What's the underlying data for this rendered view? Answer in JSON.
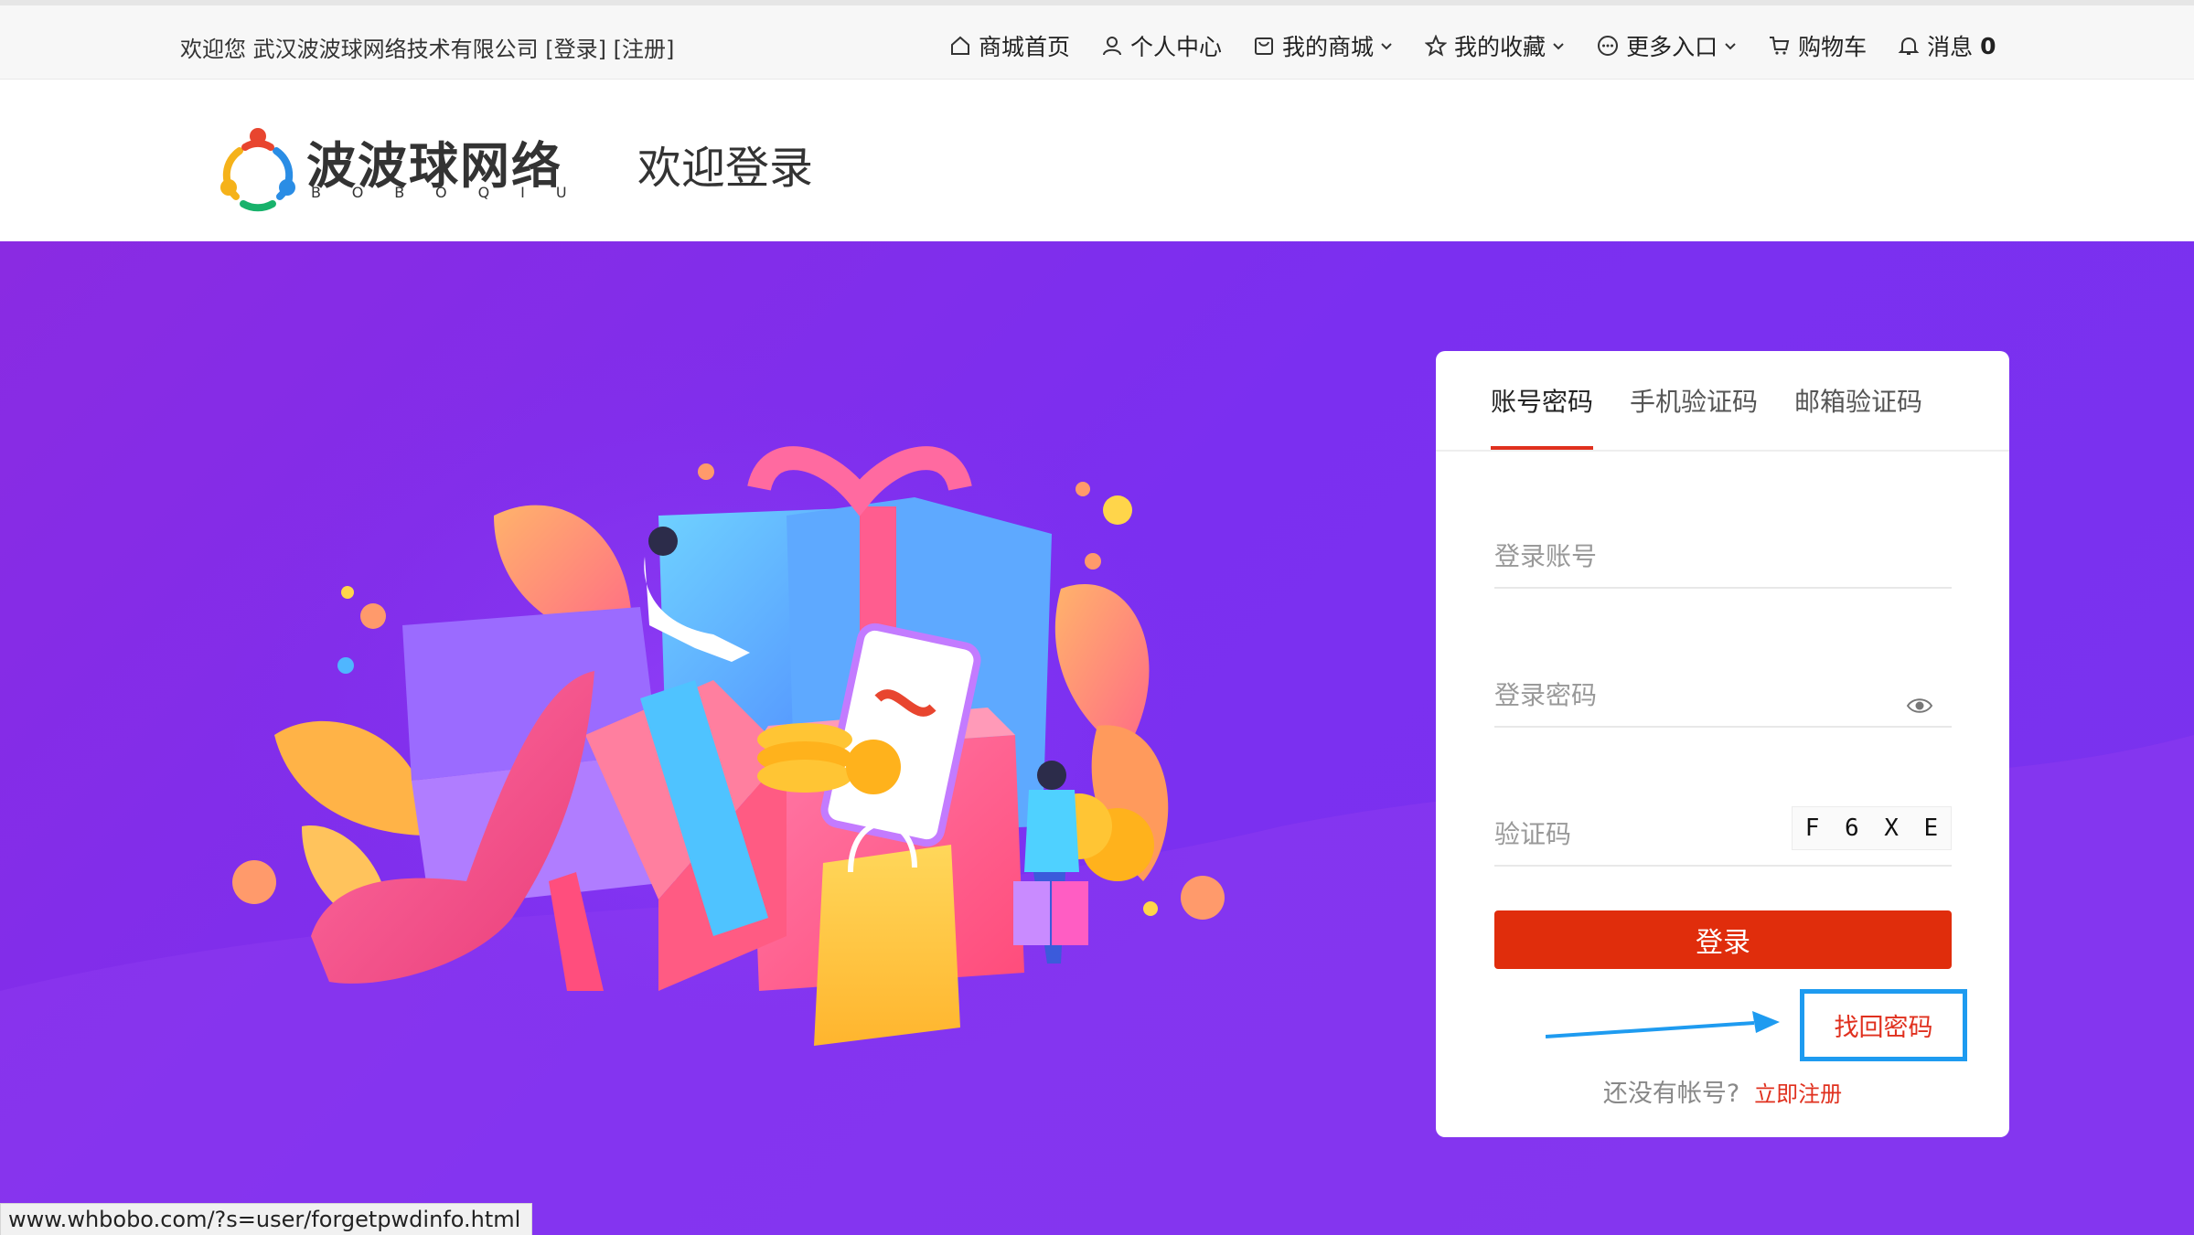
{
  "topbar": {
    "welcome_text": "欢迎您 武汉波波球网络技术有限公司",
    "login_link": "[登录]",
    "register_link": "[注册]",
    "nav": [
      {
        "label": "商城首页",
        "icon": "home-icon"
      },
      {
        "label": "个人中心",
        "icon": "user-icon"
      },
      {
        "label": "我的商城",
        "icon": "store-icon",
        "dropdown": true
      },
      {
        "label": "我的收藏",
        "icon": "star-icon",
        "dropdown": true
      },
      {
        "label": "更多入口",
        "icon": "more-icon",
        "dropdown": true
      },
      {
        "label": "购物车",
        "icon": "cart-icon"
      },
      {
        "label": "消息",
        "icon": "bell-icon",
        "badge": "0"
      }
    ]
  },
  "header": {
    "logo_text": "波波球网络",
    "logo_sub": "BOBOQIU",
    "page_title": "欢迎登录"
  },
  "login": {
    "tabs": [
      "账号密码",
      "手机验证码",
      "邮箱验证码"
    ],
    "active_tab": 0,
    "account_placeholder": "登录账号",
    "password_placeholder": "登录密码",
    "captcha_placeholder": "验证码",
    "captcha_chars": [
      "F",
      "6",
      "X",
      "E"
    ],
    "login_button": "登录",
    "forgot_password": "找回密码",
    "no_account_text": "还没有帐号?",
    "register_now": "立即注册"
  },
  "colors": {
    "accent": "#e02d0c",
    "hero_bg": "#7b2ff0",
    "highlight_border": "#1e9bf0"
  },
  "status_url": "www.whbobo.com/?s=user/forgetpwdinfo.html"
}
